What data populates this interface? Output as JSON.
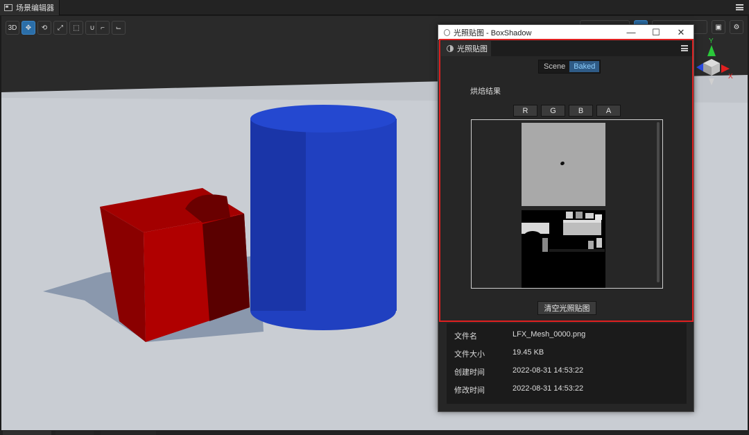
{
  "editor": {
    "tab_label": "场景编辑器",
    "mode_label": "3D"
  },
  "gizmo": {
    "y_label": "Y",
    "x_label": "X"
  },
  "window": {
    "title": "光照贴图 - BoxShadow",
    "panel_tab": "光照贴图",
    "segment": {
      "options": [
        "Scene",
        "Baked"
      ],
      "selected": "Baked"
    },
    "bake_result_label": "烘焙结果",
    "channels": [
      "R",
      "G",
      "B",
      "A"
    ],
    "clear_button": "清空光照贴图",
    "info": [
      {
        "label": "文件名",
        "value": "LFX_Mesh_0000.png"
      },
      {
        "label": "文件大小",
        "value": "19.45 KB"
      },
      {
        "label": "创建时间",
        "value": "2022-08-31 14:53:22"
      },
      {
        "label": "修改时间",
        "value": "2022-08-31 14:53:22"
      }
    ]
  },
  "colors": {
    "red_cube": "#b00000",
    "blue_cylinder": "#2340c0",
    "highlight": "#e02020",
    "accent": "#2f5b86"
  }
}
